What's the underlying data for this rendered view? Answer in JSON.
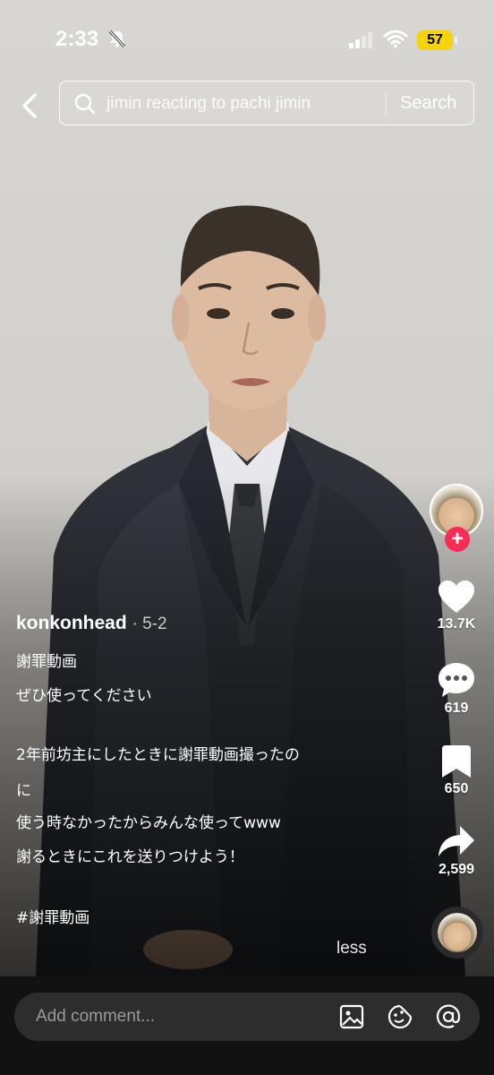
{
  "status_bar": {
    "time": "2:33",
    "battery": "57",
    "battery_color": "#f5d40a"
  },
  "search": {
    "query": "jimin reacting to pachi jimin",
    "button_label": "Search"
  },
  "rail": {
    "likes": "13.7K",
    "comments": "619",
    "bookmarks": "650",
    "shares": "2,599",
    "accent_color": "#fe2c55"
  },
  "caption": {
    "author": "konkonhead",
    "date": "5-2",
    "lines": [
      "謝罪動画",
      "ぜひ使ってください",
      "2年前坊主にしたときに謝罪動画撮ったの",
      "に",
      "使う時なかったからみんな使ってwww",
      "謝るときにこれを送りつけよう！",
      "#謝罪動画"
    ],
    "less_label": "less"
  },
  "comment_bar": {
    "placeholder": "Add comment..."
  },
  "icons": {
    "bell": "bell-muted-icon",
    "back": "chevron-left-icon",
    "search": "search-icon",
    "like": "heart-icon",
    "comment": "comment-bubble-icon",
    "bookmark": "bookmark-icon",
    "share": "share-arrow-icon",
    "image": "image-icon",
    "emoji": "emoji-icon",
    "mention": "at-icon"
  }
}
